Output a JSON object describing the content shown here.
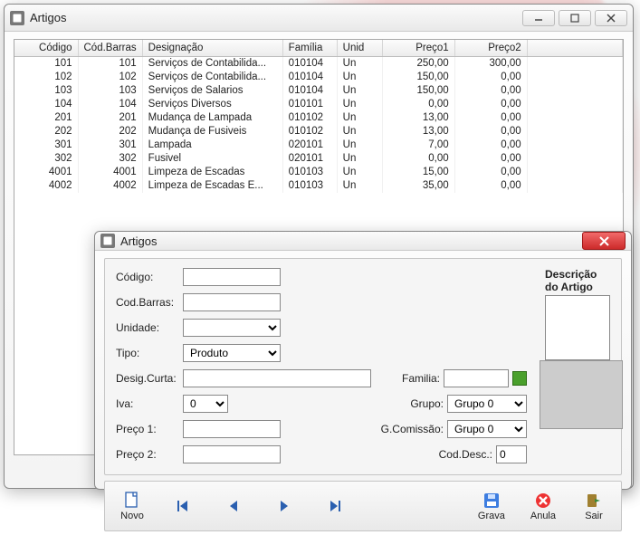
{
  "main_window": {
    "title": "Artigos",
    "columns": [
      "Código",
      "Cód.Barras",
      "Designação",
      "Família",
      "Unid",
      "Preço1",
      "Preço2"
    ],
    "rows": [
      {
        "codigo": "101",
        "codbarras": "101",
        "desig": "Serviços de Contabilida...",
        "familia": "010104",
        "unid": "Un",
        "p1": "250,00",
        "p2": "300,00"
      },
      {
        "codigo": "102",
        "codbarras": "102",
        "desig": "Serviços de Contabilida...",
        "familia": "010104",
        "unid": "Un",
        "p1": "150,00",
        "p2": "0,00"
      },
      {
        "codigo": "103",
        "codbarras": "103",
        "desig": "Serviços de Salarios",
        "familia": "010104",
        "unid": "Un",
        "p1": "150,00",
        "p2": "0,00"
      },
      {
        "codigo": "104",
        "codbarras": "104",
        "desig": "Serviços Diversos",
        "familia": "010101",
        "unid": "Un",
        "p1": "0,00",
        "p2": "0,00"
      },
      {
        "codigo": "201",
        "codbarras": "201",
        "desig": "Mudança de Lampada",
        "familia": "010102",
        "unid": "Un",
        "p1": "13,00",
        "p2": "0,00"
      },
      {
        "codigo": "202",
        "codbarras": "202",
        "desig": "Mudança de Fusiveis",
        "familia": "010102",
        "unid": "Un",
        "p1": "13,00",
        "p2": "0,00"
      },
      {
        "codigo": "301",
        "codbarras": "301",
        "desig": "Lampada",
        "familia": "020101",
        "unid": "Un",
        "p1": "7,00",
        "p2": "0,00"
      },
      {
        "codigo": "302",
        "codbarras": "302",
        "desig": "Fusivel",
        "familia": "020101",
        "unid": "Un",
        "p1": "0,00",
        "p2": "0,00"
      },
      {
        "codigo": "4001",
        "codbarras": "4001",
        "desig": "Limpeza de Escadas",
        "familia": "010103",
        "unid": "Un",
        "p1": "15,00",
        "p2": "0,00"
      },
      {
        "codigo": "4002",
        "codbarras": "4002",
        "desig": "Limpeza de Escadas E...",
        "familia": "010103",
        "unid": "Un",
        "p1": "35,00",
        "p2": "0,00"
      }
    ]
  },
  "detail_window": {
    "title": "Artigos",
    "labels": {
      "codigo": "Código:",
      "codbarras": "Cod.Barras:",
      "unidade": "Unidade:",
      "tipo": "Tipo:",
      "desigcurta": "Desig.Curta:",
      "iva": "Iva:",
      "preco1": "Preço 1:",
      "preco2": "Preço 2:",
      "familia": "Familia:",
      "grupo": "Grupo:",
      "gcomissao": "G.Comissão:",
      "coddesc": "Cod.Desc.:",
      "descricao": "Descrição do Artigo"
    },
    "values": {
      "codigo": "",
      "codbarras": "",
      "unidade": "",
      "tipo": "Produto",
      "desigcurta": "",
      "iva": "0",
      "preco1": "",
      "preco2": "",
      "familia": "",
      "grupo": "Grupo 0",
      "gcomissao": "Grupo 0",
      "coddesc": "0",
      "descricao": ""
    },
    "toolbar": {
      "novo": "Novo",
      "grava": "Grava",
      "anula": "Anula",
      "sair": "Sair"
    }
  }
}
